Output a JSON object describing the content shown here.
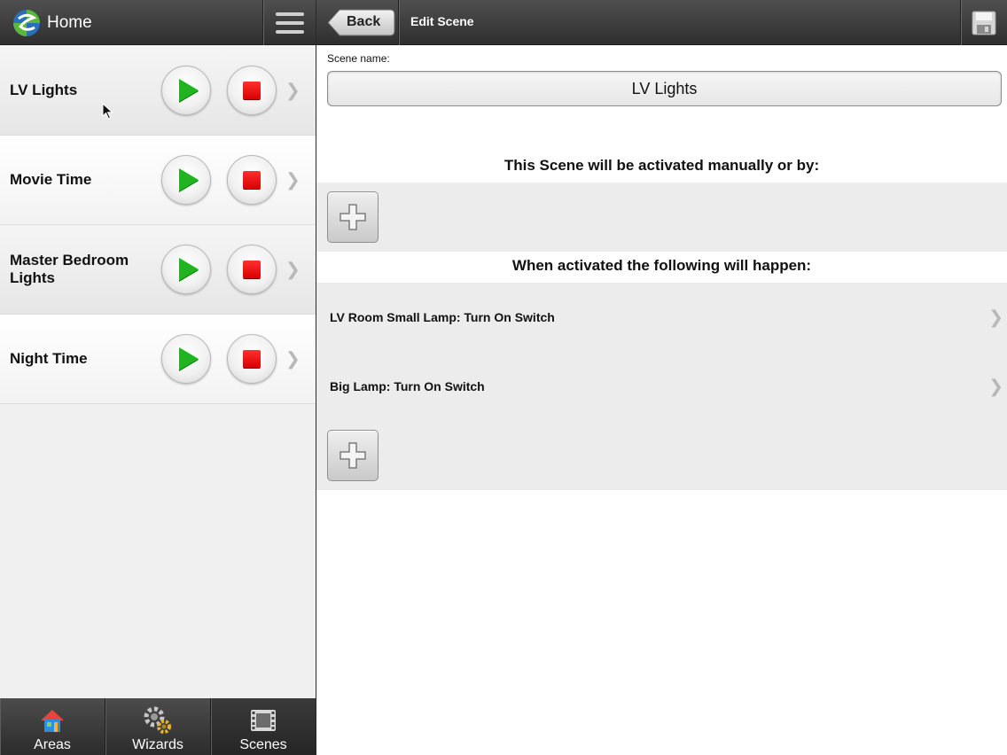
{
  "left_pane": {
    "header": {
      "title": "Home",
      "logo_icon": "globe-logo-icon",
      "menu_icon": "hamburger-menu-icon"
    },
    "scenes": [
      {
        "name": "LV Lights"
      },
      {
        "name": "Movie Time"
      },
      {
        "name": "Master Bedroom Lights"
      },
      {
        "name": "Night Time"
      }
    ],
    "tabs": [
      {
        "label": "Areas",
        "icon": "house-icon",
        "active": false
      },
      {
        "label": "Wizards",
        "icon": "gears-icon",
        "active": false
      },
      {
        "label": "Scenes",
        "icon": "film-icon",
        "active": true
      }
    ]
  },
  "right_pane": {
    "header": {
      "back_label": "Back",
      "title": "Edit Scene",
      "save_icon": "floppy-disk-icon"
    },
    "scene_name_label": "Scene name:",
    "scene_name_value": "LV Lights",
    "trigger_heading": "This Scene will be activated manually or by:",
    "actions_heading": "When activated the following will happen:",
    "actions": [
      {
        "text": "LV Room Small Lamp: Turn On Switch"
      },
      {
        "text": "Big Lamp: Turn On Switch"
      }
    ]
  },
  "colors": {
    "play": "#22b322",
    "stop": "#e00000",
    "toolbar": "#3a3a3a",
    "band": "#ececec"
  }
}
